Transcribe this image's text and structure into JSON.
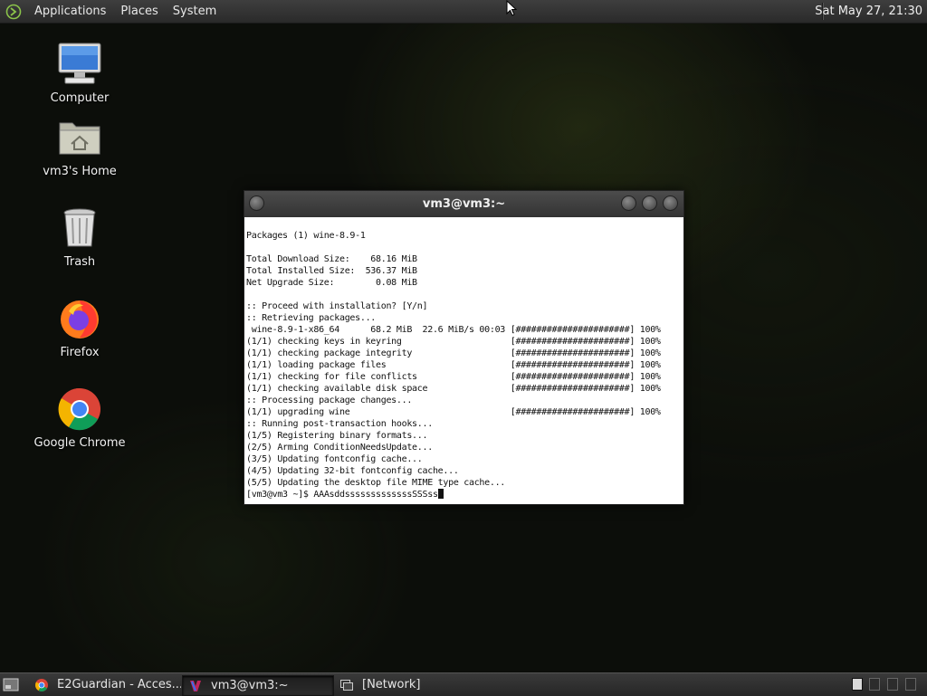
{
  "top_panel": {
    "menus": [
      "Applications",
      "Places",
      "System"
    ],
    "clock": "Sat May 27, 21:30"
  },
  "desktop": {
    "icons": [
      {
        "label": "Computer",
        "icon": "computer-icon"
      },
      {
        "label": "vm3's Home",
        "icon": "home-folder-icon"
      },
      {
        "label": "Trash",
        "icon": "trash-icon"
      },
      {
        "label": "Firefox",
        "icon": "firefox-icon"
      },
      {
        "label": "Google Chrome",
        "icon": "chrome-icon"
      }
    ]
  },
  "terminal": {
    "title": "vm3@vm3:~",
    "lines": [
      "Packages (1) wine-8.9-1",
      "",
      "Total Download Size:    68.16 MiB",
      "Total Installed Size:  536.37 MiB",
      "Net Upgrade Size:        0.08 MiB",
      "",
      ":: Proceed with installation? [Y/n]",
      ":: Retrieving packages...",
      " wine-8.9-1-x86_64      68.2 MiB  22.6 MiB/s 00:03 [######################] 100%",
      "(1/1) checking keys in keyring                     [######################] 100%",
      "(1/1) checking package integrity                   [######################] 100%",
      "(1/1) loading package files                        [######################] 100%",
      "(1/1) checking for file conflicts                  [######################] 100%",
      "(1/1) checking available disk space                [######################] 100%",
      ":: Processing package changes...",
      "(1/1) upgrading wine                               [######################] 100%",
      ":: Running post-transaction hooks...",
      "(1/5) Registering binary formats...",
      "(2/5) Arming ConditionNeedsUpdate...",
      "(3/5) Updating fontconfig cache...",
      "(4/5) Updating 32-bit fontconfig cache...",
      "(5/5) Updating the desktop file MIME type cache..."
    ],
    "prompt": "[vm3@vm3 ~]$ ",
    "input": "AAAsddsssssssssssssSSSss"
  },
  "taskbar": {
    "tasks": [
      {
        "label": "E2Guardian - Acces...",
        "icon": "chrome-icon",
        "active": false
      },
      {
        "label": "vm3@vm3:~",
        "icon": "terminal-icon",
        "active": true
      },
      {
        "label": "[Network]",
        "icon": "window-icon",
        "active": false
      }
    ]
  },
  "colors": {
    "panel": "#2e2e2e",
    "terminal_bg": "#ffffff",
    "desktop_bg": "#0c0e0a"
  }
}
